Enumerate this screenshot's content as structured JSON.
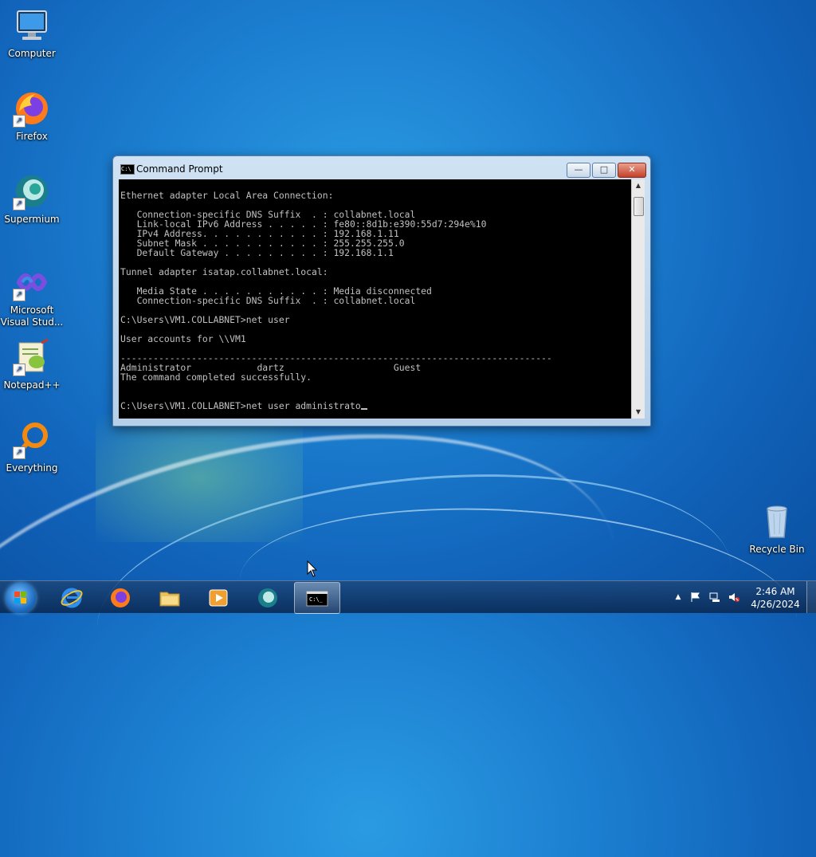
{
  "desktop": {
    "icons": [
      {
        "label": "Computer"
      },
      {
        "label": "Firefox"
      },
      {
        "label": "Supermium"
      },
      {
        "label": "Microsoft Visual Stud..."
      },
      {
        "label": "Notepad++"
      },
      {
        "label": "Everything"
      },
      {
        "label": "Recycle Bin"
      }
    ]
  },
  "window": {
    "title": "Command Prompt",
    "minimize_label": "—",
    "maximize_label": "□",
    "close_label": "✕",
    "console_lines": [
      "",
      "Ethernet adapter Local Area Connection:",
      "",
      "   Connection-specific DNS Suffix  . : collabnet.local",
      "   Link-local IPv6 Address . . . . . : fe80::8d1b:e390:55d7:294e%10",
      "   IPv4 Address. . . . . . . . . . . : 192.168.1.11",
      "   Subnet Mask . . . . . . . . . . . : 255.255.255.0",
      "   Default Gateway . . . . . . . . . : 192.168.1.1",
      "",
      "Tunnel adapter isatap.collabnet.local:",
      "",
      "   Media State . . . . . . . . . . . : Media disconnected",
      "   Connection-specific DNS Suffix  . : collabnet.local",
      "",
      "C:\\Users\\VM1.COLLABNET>net user",
      "",
      "User accounts for \\\\VM1",
      "",
      "-------------------------------------------------------------------------------",
      "Administrator            dartz                    Guest",
      "The command completed successfully.",
      "",
      ""
    ],
    "prompt_line": "C:\\Users\\VM1.COLLABNET>net user administrato"
  },
  "taskbar": {
    "apps": [
      {
        "name": "Internet Explorer"
      },
      {
        "name": "Firefox"
      },
      {
        "name": "File Explorer"
      },
      {
        "name": "Media Player"
      },
      {
        "name": "Supermium"
      },
      {
        "name": "Command Prompt"
      }
    ],
    "tray": {
      "show_hidden": "▲",
      "clock_time": "2:46 AM",
      "clock_date": "4/26/2024"
    }
  },
  "colors": {
    "console_bg": "#000000",
    "console_fg": "#c0c0c0",
    "close_button": "#c4412b"
  }
}
